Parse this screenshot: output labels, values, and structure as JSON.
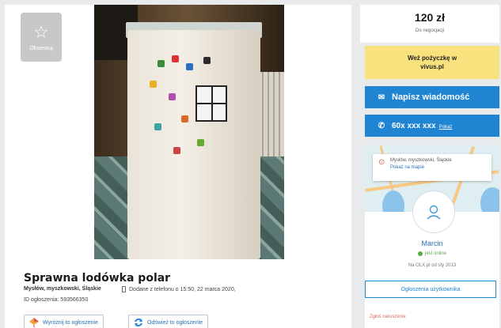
{
  "listing": {
    "favorite_label": "Obserwuj",
    "title": "Sprawna lodówka polar",
    "location": "Mysłów, myszkowski, Śląskie",
    "added": "Dodane z telefonu  o 15:50, 22 marca 2020,",
    "ad_id": "ID ogłoszenia: 593566350",
    "promote_label": "Wyróżnij to ogłoszenie",
    "refresh_label": "Odśwież to ogłoszenie"
  },
  "price": {
    "amount": "120 zł",
    "negotiable": "Do negocjacji"
  },
  "loan": {
    "line1": "Weź pożyczkę w",
    "line2": "vivus.pl"
  },
  "contact": {
    "message_label": "Napisz wiadomość",
    "phone_masked": "60x xxx xxx",
    "show_label": "Pokaż"
  },
  "map": {
    "location": "Mysłów, myszkowski, Śląskie",
    "show_on_map": "Pokaż na mapie"
  },
  "seller": {
    "name": "Marcin",
    "status": "jest online",
    "since": "Na OLX.pl od sty 2013",
    "user_ads_label": "Ogłoszenia użytkownika",
    "report_label": "Zgłoś naruszenie"
  },
  "colors": {
    "accent_blue": "#1f85d2",
    "loan_yellow": "#f9e27d",
    "online_green": "#5aa84a"
  }
}
